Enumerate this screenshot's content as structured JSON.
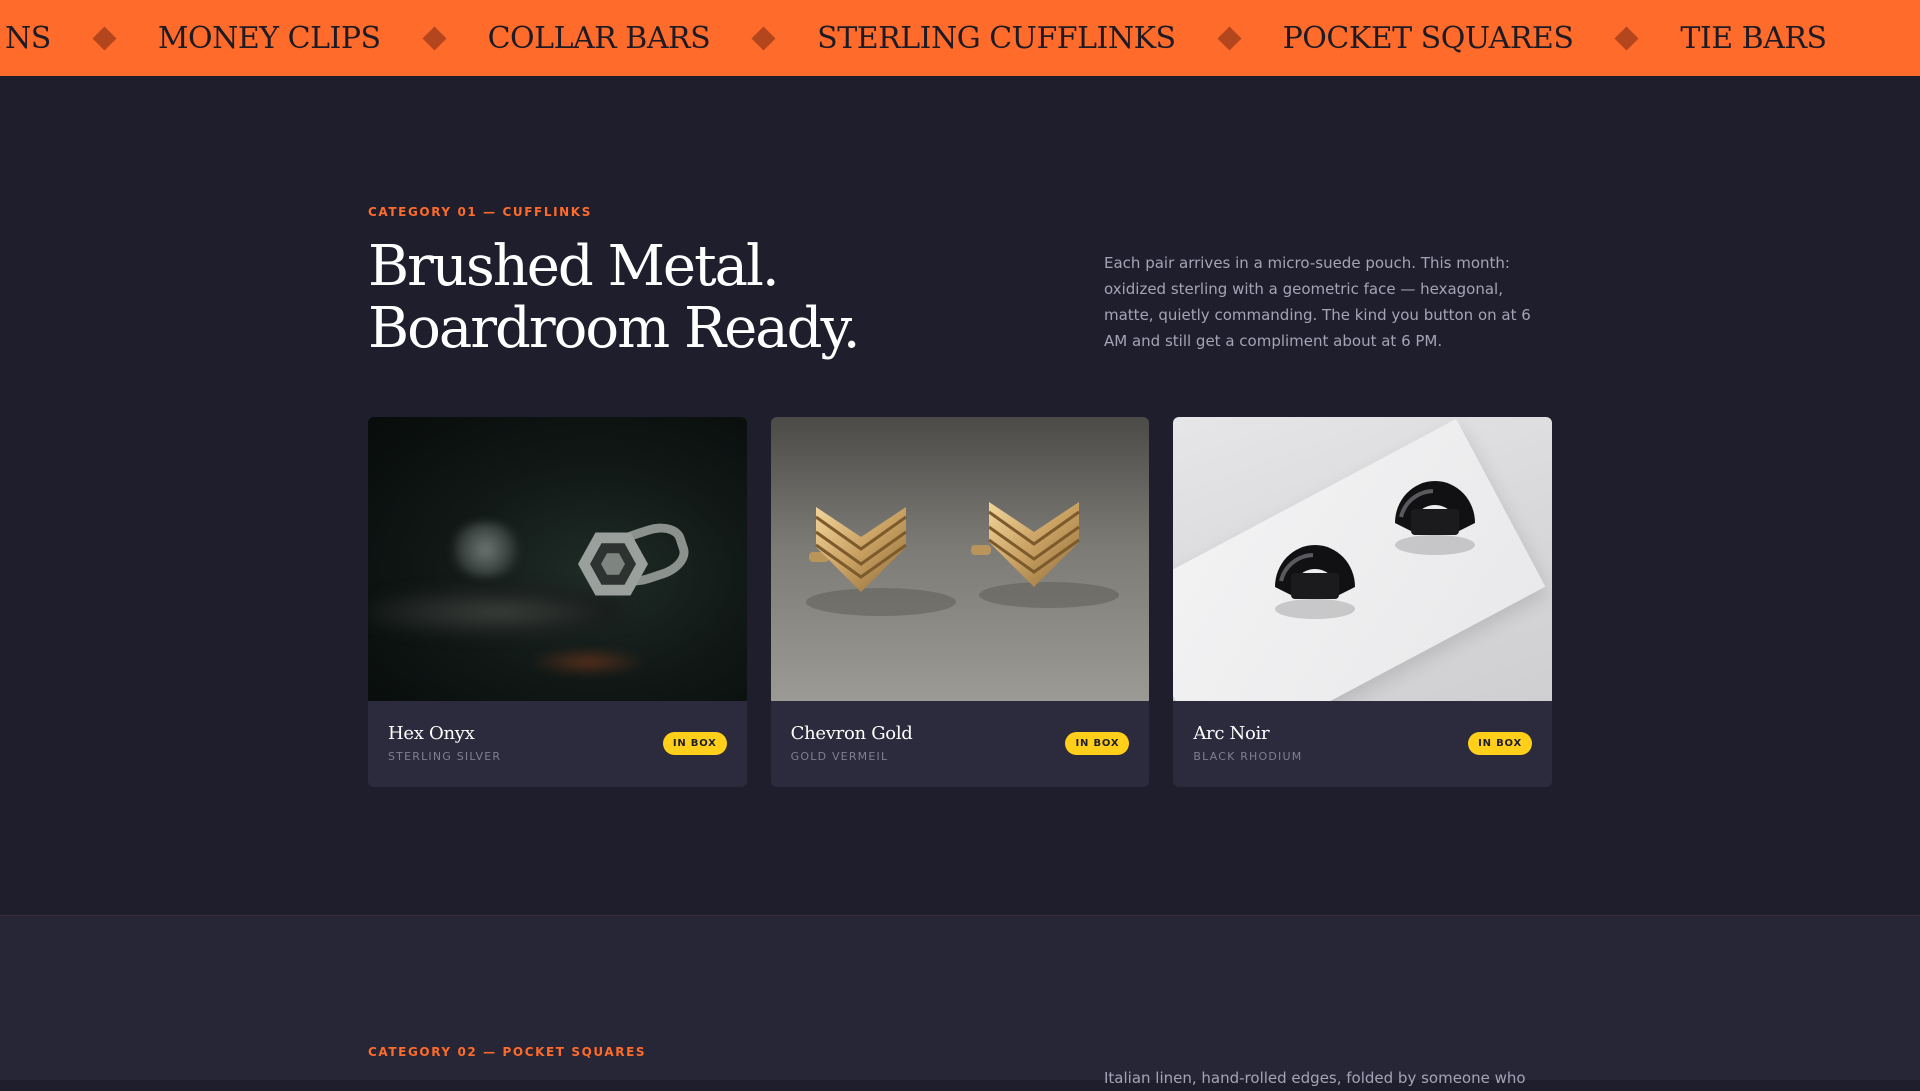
{
  "marquee": {
    "items": [
      "NS",
      "MONEY CLIPS",
      "COLLAR BARS",
      "STERLING CUFFLINKS",
      "POCKET SQUARES",
      "TIE BARS"
    ]
  },
  "category_1": {
    "eyebrow": "CATEGORY 01 — CUFFLINKS",
    "headline_line1": "Brushed Metal.",
    "headline_line2": "Boardroom Ready.",
    "description": "Each pair arrives in a micro-suede pouch. This month: oxidized sterling with a geometric face — hexagonal, matte, quietly commanding. The kind you button on at 6 AM and still get a compliment about at 6 PM.",
    "products": [
      {
        "name": "Hex Onyx",
        "material": "STERLING SILVER",
        "badge": "IN BOX"
      },
      {
        "name": "Chevron Gold",
        "material": "GOLD VERMEIL",
        "badge": "IN BOX"
      },
      {
        "name": "Arc Noir",
        "material": "BLACK RHODIUM",
        "badge": "IN BOX"
      }
    ]
  },
  "category_2": {
    "eyebrow": "CATEGORY 02 — POCKET SQUARES",
    "description_partial": "Italian linen, hand-rolled edges, folded by someone who"
  },
  "colors": {
    "accent_orange": "#ff6b2b",
    "badge_yellow": "#ffcf1a",
    "background": "#1e1e2c",
    "card": "#2c2b3d"
  }
}
